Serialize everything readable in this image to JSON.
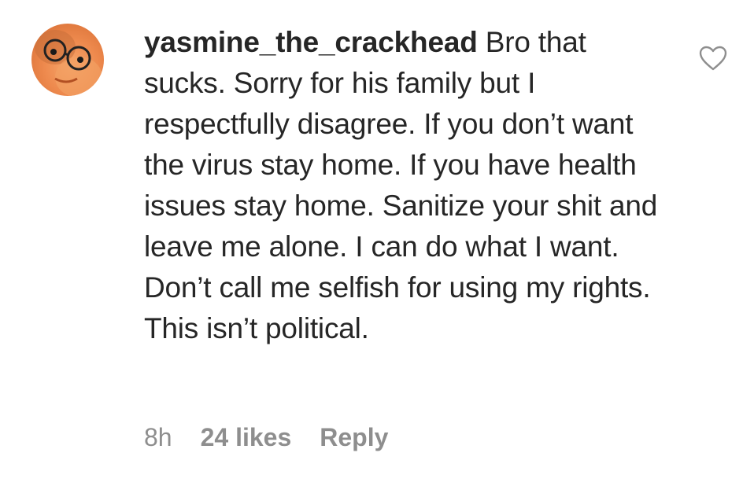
{
  "comment": {
    "username": "yasmine_the_crackhead",
    "text": "Bro that sucks. Sorry for his family but I respectfully disagree. If you don’t want the virus stay home. If you have health issues stay home. Sanitize your shit and leave me alone. I can do what I want. Don’t call me selfish for using my rights. This isn’t political.",
    "time": "8h",
    "likes": "24 likes",
    "reply_label": "Reply"
  },
  "icons": {
    "avatar": "profile-photo",
    "like": "heart-outline-icon"
  },
  "colors": {
    "text": "#262626",
    "secondary": "#8e8e8e"
  }
}
